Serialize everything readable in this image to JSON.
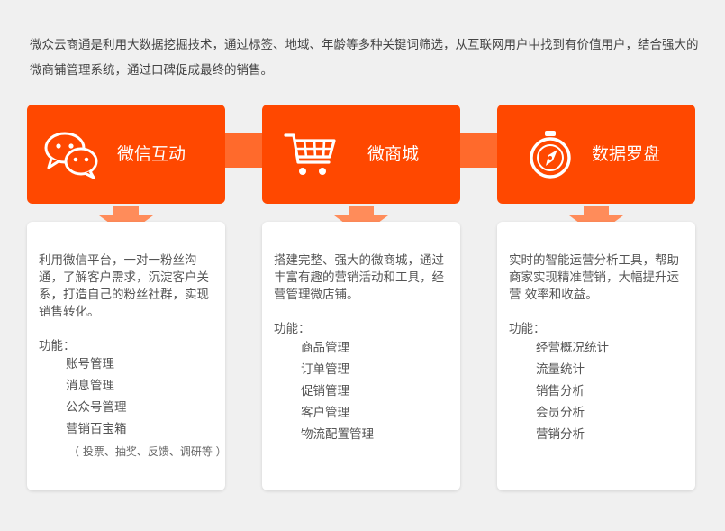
{
  "intro": "微众云商通是利用大数据挖掘技术，通过标签、地域、年龄等多种关键词筛选，从互联网用户中找到有价值用户，结合强大的微商铺管理系统，通过口碑促成最终的销售。",
  "function_label": "功能：",
  "colors": {
    "accent": "#ff4800",
    "connector": "#ff6a2c",
    "arrow": "#ff8c5a"
  },
  "cards": [
    {
      "icon": "wechat-chat-bubbles-icon",
      "title": "微信互动",
      "description": "利用微信平台，一对一粉丝沟通，了解客户需求，沉淀客户关系，打造自己的粉丝社群，实现销售转化。",
      "features": [
        "账号管理",
        "消息管理",
        "公众号管理",
        "营销百宝箱"
      ],
      "note": "（ 投票、抽奖、反馈、调研等 ）"
    },
    {
      "icon": "shopping-cart-icon",
      "title": "微商城",
      "description": "搭建完整、强大的微商城，通过丰富有趣的营销活动和工具，经营管理微店铺。",
      "features": [
        "商品管理",
        "订单管理",
        "促销管理",
        "客户管理",
        "物流配置管理"
      ]
    },
    {
      "icon": "compass-icon",
      "title": "数据罗盘",
      "description": "实时的智能运营分析工具，帮助商家实现精准营销，大幅提升运营 效率和收益。",
      "features": [
        "经营概况统计",
        "流量统计",
        "销售分析",
        "会员分析",
        "营销分析"
      ]
    }
  ]
}
